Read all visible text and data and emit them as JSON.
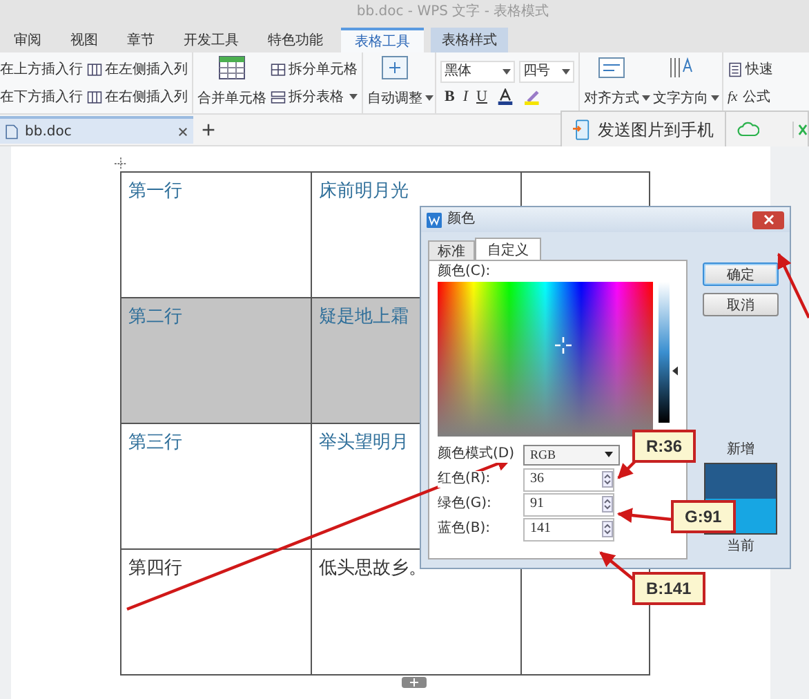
{
  "window": {
    "title": "bb.doc - WPS 文字 - 表格模式"
  },
  "ribbon_tabs": [
    {
      "label": "审阅",
      "selected": false
    },
    {
      "label": "视图",
      "selected": false
    },
    {
      "label": "章节",
      "selected": false
    },
    {
      "label": "开发工具",
      "selected": false
    },
    {
      "label": "特色功能",
      "selected": false
    },
    {
      "label": "表格工具",
      "selected": true
    },
    {
      "label": "表格样式",
      "selected": false
    }
  ],
  "ribbon": {
    "insert": [
      "在上方插入行",
      "在左侧插入列",
      "在下方插入行",
      "在右侧插入列"
    ],
    "merge": {
      "big": "合并单元格",
      "split_cells": "拆分单元格",
      "split_table": "拆分表格"
    },
    "autofit": "自动调整",
    "font": "黑体",
    "size": "四号",
    "format_buttons": [
      "B",
      "I",
      "U"
    ],
    "align": "对齐方式",
    "direction": "文字方向",
    "quick_calc": "快速",
    "formula_icon": "fx",
    "formula": "公式"
  },
  "doc_tabs": [
    {
      "label": "bb.doc",
      "selected": true
    }
  ],
  "send_bar": {
    "label": "发送图片到手机"
  },
  "table": {
    "rows": [
      {
        "cells": [
          "第一行",
          "床前明月光"
        ],
        "selected": false,
        "color": "#2f6f9a"
      },
      {
        "cells": [
          "第二行",
          "疑是地上霜"
        ],
        "selected": true,
        "color": "#2f6f9a"
      },
      {
        "cells": [
          "第三行",
          "举头望明月"
        ],
        "selected": false,
        "color": "#2f6f9a"
      },
      {
        "cells": [
          "第四行",
          "低头思故乡。"
        ],
        "selected": false,
        "color": "#333333"
      }
    ]
  },
  "dialog": {
    "title": "颜色",
    "tabs": [
      {
        "label": "标准",
        "selected": false
      },
      {
        "label": "自定义",
        "selected": true
      }
    ],
    "colors_label": "颜色(C):",
    "luminance": {
      "level": 0.36
    },
    "mode_label": "颜色模式(D)",
    "mode": "RGB",
    "fields": [
      {
        "label": "红色(R):",
        "value": "36"
      },
      {
        "label": "绿色(G):",
        "value": "91"
      },
      {
        "label": "蓝色(B):",
        "value": "141"
      }
    ],
    "buttons": [
      "确定",
      "取消"
    ],
    "new_label": "新增",
    "current_label": "当前"
  },
  "callouts": [
    "R:36",
    "G:91",
    "B:141"
  ]
}
